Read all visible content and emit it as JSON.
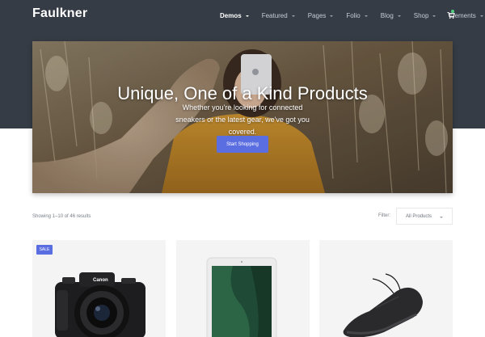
{
  "brand": {
    "logo": "Faulkner"
  },
  "nav": {
    "items": [
      {
        "label": "Demos",
        "active": true
      },
      {
        "label": "Featured"
      },
      {
        "label": "Pages"
      },
      {
        "label": "Folio"
      },
      {
        "label": "Blog"
      },
      {
        "label": "Shop"
      },
      {
        "label": "Elements"
      }
    ]
  },
  "hero": {
    "title": "Unique, One of a Kind Products",
    "subtitle": "Whether you're looking for connected sneakers or the latest gear, we've got you covered.",
    "button": "Start Shopping"
  },
  "shop": {
    "results": "Showing 1–10 of 46 results",
    "filter_label": "Filter:",
    "filter_value": "All Products"
  },
  "products": [
    {
      "badge": "SALE",
      "image": "camera"
    },
    {
      "image": "tablet"
    },
    {
      "image": "sneaker"
    }
  ],
  "colors": {
    "header": "#353c45",
    "accent": "#5b6ee1",
    "cart_dot": "#4fd07e"
  }
}
